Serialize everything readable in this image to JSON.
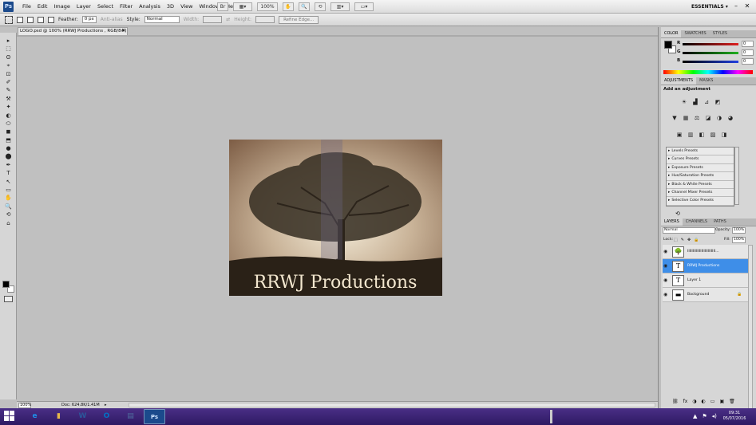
{
  "app": {
    "logo": "Ps",
    "menu": [
      "File",
      "Edit",
      "Image",
      "Layer",
      "Select",
      "Filter",
      "Analysis",
      "3D",
      "View",
      "Window",
      "Help"
    ],
    "zoom_level": "100%",
    "workspace": "ESSENTIALS",
    "workspace_arrow": "▾",
    "minimize": "–",
    "close": "✕"
  },
  "options_bar": {
    "feather_label": "Feather:",
    "feather_value": "0 px",
    "antialias_label": "Anti-alias",
    "style_label": "Style:",
    "style_value": "Normal",
    "width_label": "Width:",
    "height_label": "Height:",
    "refine_edge": "Refine Edge..."
  },
  "document": {
    "tab_title": "LOGO.psd @ 100% (RRWJ Productions , RGB/8#)",
    "tab_close": "×",
    "canvas_text": "RRWJ Productions"
  },
  "status_bar": {
    "zoom": "100%",
    "doc_size": "Doc: 624.8K/1.41M",
    "arrow": "▸"
  },
  "tools": [
    "▸",
    "⬚",
    "ʘ",
    "⌖",
    "⊡",
    "✐",
    "✎",
    "⚒",
    "✦",
    "◐",
    "⬭",
    "◼",
    "⬒",
    "●",
    "⬤",
    "✒",
    "T",
    "↖",
    "▭",
    "✋",
    "🔍",
    "⟲",
    "⌂"
  ],
  "color_panel": {
    "tabs": [
      "COLOR",
      "SWATCHES",
      "STYLES"
    ],
    "sliders": [
      {
        "label": "R",
        "value": "0",
        "color": "#e02020"
      },
      {
        "label": "G",
        "value": "0",
        "color": "#20b020"
      },
      {
        "label": "B",
        "value": "0",
        "color": "#2040e0"
      }
    ]
  },
  "adjustments_panel": {
    "tabs": [
      "ADJUSTMENTS",
      "MASKS"
    ],
    "title": "Add an adjustment",
    "icon_rows": [
      [
        "☀",
        "▟",
        "⊿",
        "◩"
      ],
      [
        "▼",
        "▦",
        "⚖",
        "◪",
        "◑",
        "◕"
      ],
      [
        "▣",
        "▥",
        "◧",
        "▨",
        "◨"
      ]
    ],
    "presets": [
      "Levels Presets",
      "Curves Presets",
      "Exposure Presets",
      "Hue/Saturation Presets",
      "Black & White Presets",
      "Channel Mixer Presets",
      "Selective Color Presets"
    ],
    "preset_arrow": "▸",
    "footer_icon": "⟲"
  },
  "layers_panel": {
    "tabs": [
      "LAYERS",
      "CHANNELS",
      "PATHS"
    ],
    "blend_mode": "Normal",
    "opacity_label": "Opacity:",
    "opacity_value": "100%",
    "lock_label": "Lock:",
    "lock_icons": [
      "⬚",
      "✎",
      "✥",
      "🔒"
    ],
    "fill_label": "Fill:",
    "fill_value": "100%",
    "layers": [
      {
        "name": "IIIIIIIIIIIIIIIIIIIIIIIIII...",
        "thumb": "🌳",
        "selected": false
      },
      {
        "name": "RRWJ Productions",
        "thumb": "T",
        "selected": true
      },
      {
        "name": "Layer 1",
        "thumb": "T",
        "selected": false
      },
      {
        "name": "Background",
        "thumb": "▬",
        "selected": false,
        "locked": true
      }
    ],
    "eye": "◉",
    "lock": "🔒",
    "footer_icons": [
      "⛓",
      "fx",
      "◑",
      "◐",
      "▭",
      "▣",
      "🗑"
    ]
  },
  "taskbar": {
    "apps": [
      {
        "label": "e",
        "color": "#1f8ee8",
        "active": false
      },
      {
        "label": "▮",
        "color": "#e8b84a",
        "active": false
      },
      {
        "label": "W",
        "color": "#2b579a",
        "active": false
      },
      {
        "label": "O",
        "color": "#0072c6",
        "active": false
      },
      {
        "label": "▤",
        "color": "#4f6f9f",
        "active": false
      },
      {
        "label": "Ps",
        "color": "#1b4a8c",
        "active": true
      }
    ],
    "tray": [
      "▲",
      "⚑",
      "◂)"
    ],
    "time": "09:31",
    "date": "05/07/2016"
  },
  "colors": {
    "selected_layer": "#3e8ee8",
    "taskbar": "#3a2475",
    "ps_blue": "#1b4a8c"
  }
}
